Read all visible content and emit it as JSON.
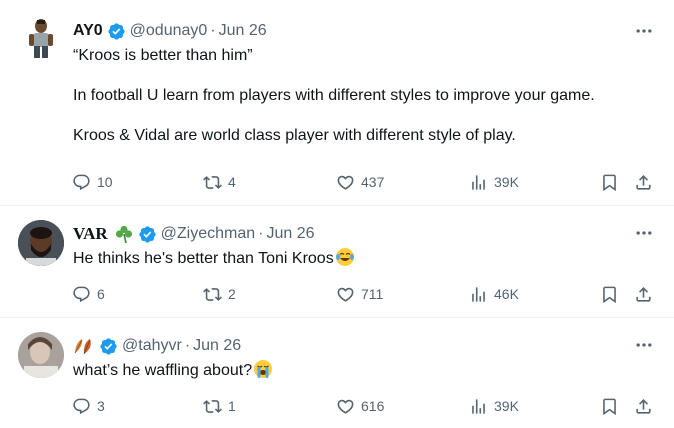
{
  "tweets": [
    {
      "name": "AY0",
      "handle": "@odunay0",
      "dot": "·",
      "time": "Jun 26",
      "paragraphs": [
        "“Kroos is better than him”",
        "In football U learn from players with different styles to improve your game.",
        "Kroos & Vidal are world class player with different style of play."
      ],
      "replies": "10",
      "reposts": "4",
      "likes": "437",
      "views": "39K"
    },
    {
      "name": "VAR",
      "name_emoji": "shamrock",
      "handle": "@Ziyechman",
      "dot": "·",
      "time": "Jun 26",
      "text": "He thinks he's better than Toni Kroos",
      "text_emoji": "tears-of-joy",
      "replies": "6",
      "reposts": "2",
      "likes": "711",
      "views": "46K"
    },
    {
      "name_emoji": "leaves",
      "handle": "@tahyvr",
      "dot": "·",
      "time": "Jun 26",
      "text": "what’s he waffling about?",
      "text_emoji": "loudly-crying",
      "replies": "3",
      "reposts": "1",
      "likes": "616",
      "views": "39K"
    }
  ],
  "colors": {
    "text": "#0f1419",
    "secondary": "#536471",
    "verified": "#1d9bf0",
    "divider": "#eff3f4"
  }
}
